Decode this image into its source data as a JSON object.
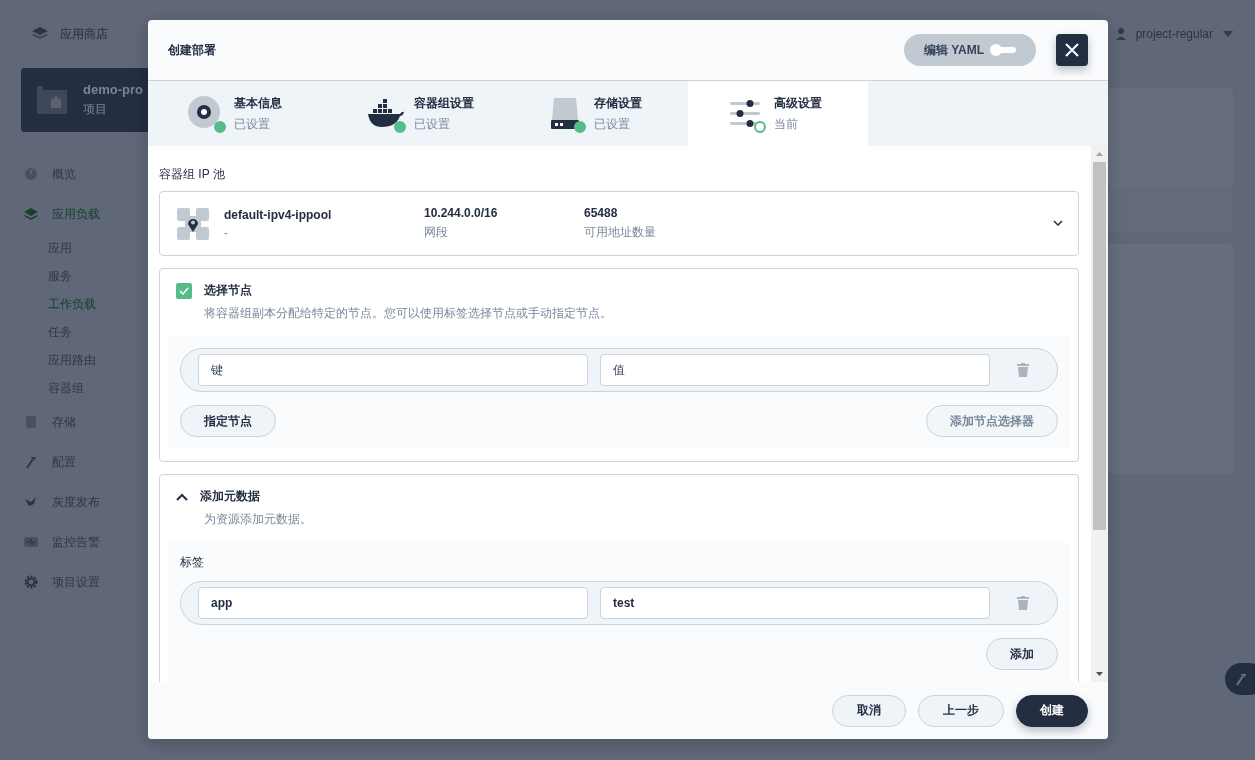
{
  "app_store": {
    "label": "应用商店"
  },
  "project": {
    "name": "demo-pro",
    "type": "项目"
  },
  "nav": [
    {
      "label": "概览",
      "selected": false
    },
    {
      "label": "应用负载",
      "selected": true,
      "children": [
        {
          "label": "应用",
          "selected": false
        },
        {
          "label": "服务",
          "selected": false
        },
        {
          "label": "工作负载",
          "selected": true
        },
        {
          "label": "任务",
          "selected": false
        },
        {
          "label": "应用路由",
          "selected": false
        },
        {
          "label": "容器组",
          "selected": false
        }
      ]
    },
    {
      "label": "存储",
      "selected": false
    },
    {
      "label": "配置",
      "selected": false
    },
    {
      "label": "灰度发布",
      "selected": false
    },
    {
      "label": "监控告警",
      "selected": false
    },
    {
      "label": "项目设置",
      "selected": false
    }
  ],
  "user": {
    "name": "project-regular"
  },
  "dialog": {
    "title": "创建部署",
    "yaml_toggle": {
      "label": "编辑 YAML",
      "on": false
    },
    "steps": [
      {
        "title": "基本信息",
        "status": "已设置",
        "done": true,
        "selected": false
      },
      {
        "title": "容器组设置",
        "status": "已设置",
        "done": true,
        "selected": false
      },
      {
        "title": "存储设置",
        "status": "已设置",
        "done": true,
        "selected": false
      },
      {
        "title": "高级设置",
        "status": "当前",
        "done": false,
        "selected": true
      }
    ],
    "ip_pool": {
      "label": "容器组 IP 池",
      "name": "default-ipv4-ippool",
      "description": "-",
      "cidr": "10.244.0.0/16",
      "cidr_label": "网段",
      "count": "65488",
      "count_label": "可用地址数量"
    },
    "node_selector": {
      "checked": true,
      "title": "选择节点",
      "description": "将容器组副本分配给特定的节点。您可以使用标签选择节点或手动指定节点。",
      "rows": [
        {
          "key_placeholder": "键",
          "value_placeholder": "值"
        }
      ],
      "assign_button": "指定节点",
      "add_button": {
        "label": "添加节点选择器",
        "disabled": true
      }
    },
    "metadata": {
      "expanded": true,
      "title": "添加元数据",
      "description": "为资源添加元数据。",
      "labels_title": "标签",
      "labels": [
        {
          "key": "app",
          "value": "test"
        }
      ],
      "add_button": "添加"
    },
    "footer": [
      {
        "label": "取消",
        "kind": "default"
      },
      {
        "label": "上一步",
        "kind": "default"
      },
      {
        "label": "创建",
        "kind": "primary"
      }
    ]
  }
}
